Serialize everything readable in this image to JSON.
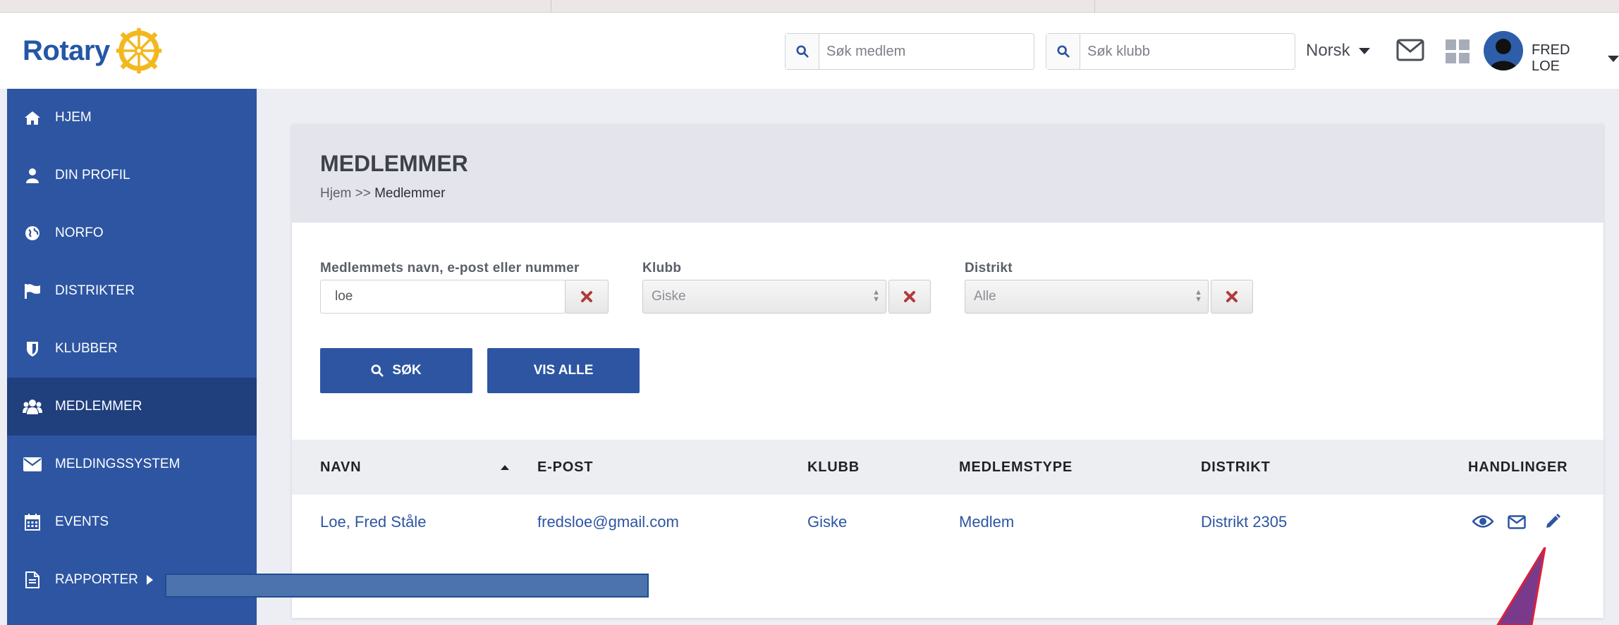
{
  "header": {
    "logo_text": "Rotary",
    "search_member_placeholder": "Søk medlem",
    "search_club_placeholder": "Søk klubb",
    "language": "Norsk",
    "user_name": "FRED LOE"
  },
  "sidebar": {
    "items": [
      {
        "label": "HJEM",
        "icon": "home-icon"
      },
      {
        "label": "DIN PROFIL",
        "icon": "user-icon"
      },
      {
        "label": "NORFO",
        "icon": "globe-icon"
      },
      {
        "label": "DISTRIKTER",
        "icon": "flag-icon"
      },
      {
        "label": "KLUBBER",
        "icon": "shield-icon"
      },
      {
        "label": "MEDLEMMER",
        "icon": "users-icon",
        "active": true
      },
      {
        "label": "MELDINGSSYSTEM",
        "icon": "envelope-icon"
      },
      {
        "label": "EVENTS",
        "icon": "calendar-icon"
      },
      {
        "label": "RAPPORTER",
        "icon": "document-icon"
      }
    ]
  },
  "page": {
    "title": "MEDLEMMER",
    "breadcrumb_home": "Hjem",
    "breadcrumb_sep": ">>",
    "breadcrumb_current": "Medlemmer"
  },
  "filters": {
    "name_label": "Medlemmets navn, e-post eller nummer",
    "name_value": "loe",
    "club_label": "Klubb",
    "club_value": "Giske",
    "district_label": "Distrikt",
    "district_value": "Alle"
  },
  "buttons": {
    "search": "SØK",
    "show_all": "VIS ALLE"
  },
  "table": {
    "headers": [
      "NAVN",
      "E-POST",
      "KLUBB",
      "MEDLEMSTYPE",
      "DISTRIKT",
      "HANDLINGER"
    ],
    "rows": [
      {
        "name": "Loe, Fred Ståle",
        "email": "fredsloe@gmail.com",
        "club": "Giske",
        "type": "Medlem",
        "district": "Distrikt 2305"
      }
    ]
  },
  "colors": {
    "sidebar": "#2d55a2",
    "sidebar_active": "#1f3f7d",
    "accent": "#2d55a2",
    "clear_x": "#b23a3a",
    "annotation_arrow": "#7a3a8c"
  }
}
